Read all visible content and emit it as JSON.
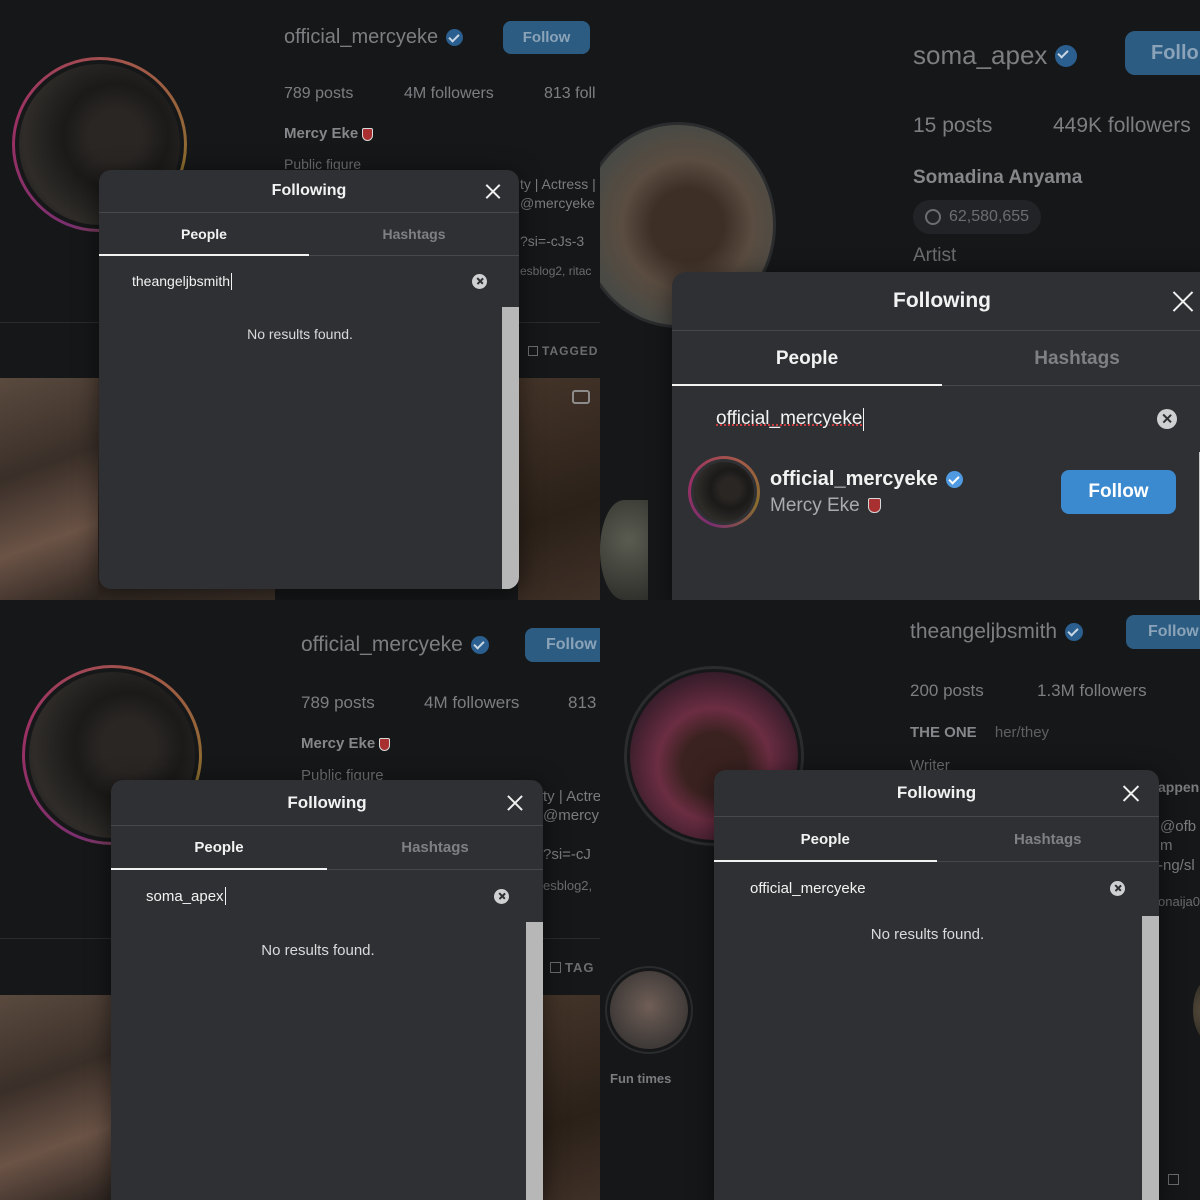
{
  "panel_tl": {
    "profile": {
      "username": "official_mercyeke",
      "follow_label": "Follow",
      "posts": "789 posts",
      "followers": "4M followers",
      "following": "813 foll",
      "name": "Mercy Eke",
      "category": "Public figure",
      "bio_fragment_1": "ty | Actress |",
      "bio_fragment_2": "@mercyeke",
      "bio_fragment_3": "?si=-cJs-3",
      "bio_fragment_4": "esblog2, ritac",
      "tagged_label": "TAGGED"
    },
    "modal": {
      "title": "Following",
      "tab_people": "People",
      "tab_hashtags": "Hashtags",
      "search_value": "theangeljbsmith",
      "no_results": "No results found."
    }
  },
  "panel_tr": {
    "profile": {
      "username": "soma_apex",
      "follow_label": "Follo",
      "posts": "15 posts",
      "followers": "449K followers",
      "name": "Somadina Anyama",
      "threads_count": "62,580,655",
      "category": "Artist"
    },
    "modal": {
      "title": "Following",
      "tab_people": "People",
      "tab_hashtags": "Hashtags",
      "search_value": "official_mercyeke",
      "result": {
        "username": "official_mercyeke",
        "full_name": "Mercy Eke",
        "follow_label": "Follow"
      }
    }
  },
  "panel_bl": {
    "profile": {
      "username": "official_mercyeke",
      "follow_label": "Follow",
      "posts": "789 posts",
      "followers": "4M followers",
      "following": "813",
      "name": "Mercy Eke",
      "category": "Public figure",
      "bio_fragment_1": "ty | Actre",
      "bio_fragment_2": "@mercy",
      "bio_fragment_3": "?si=-cJ",
      "bio_fragment_4": "esblog2,",
      "tagged_label": "TAG"
    },
    "modal": {
      "title": "Following",
      "tab_people": "People",
      "tab_hashtags": "Hashtags",
      "search_value": "soma_apex",
      "no_results": "No results found."
    }
  },
  "panel_br": {
    "profile": {
      "username": "theangeljbsmith",
      "follow_label": "Follow",
      "posts": "200 posts",
      "followers": "1.3M followers",
      "name": "THE ONE",
      "pronouns": "her/they",
      "category": "Writer",
      "bio_fragment_1": "appen",
      "bio_fragment_2": "@ofb",
      "bio_fragment_3": "m",
      "bio_fragment_4": "-ng/sl",
      "bio_fragment_5": "onaija0",
      "highlight_label": "Fun times"
    },
    "modal": {
      "title": "Following",
      "tab_people": "People",
      "tab_hashtags": "Hashtags",
      "search_value": "official_mercyeke",
      "no_results": "No results found."
    }
  },
  "colors": {
    "background": "#161718",
    "modal": "#2f3033",
    "follow_button": "#3b8ad0",
    "verified": "#4f9ae0"
  },
  "icons": [
    "verified-icon",
    "close-icon",
    "clear-search-icon",
    "threads-icon",
    "shield-icon",
    "tagged-icon",
    "reel-icon"
  ]
}
